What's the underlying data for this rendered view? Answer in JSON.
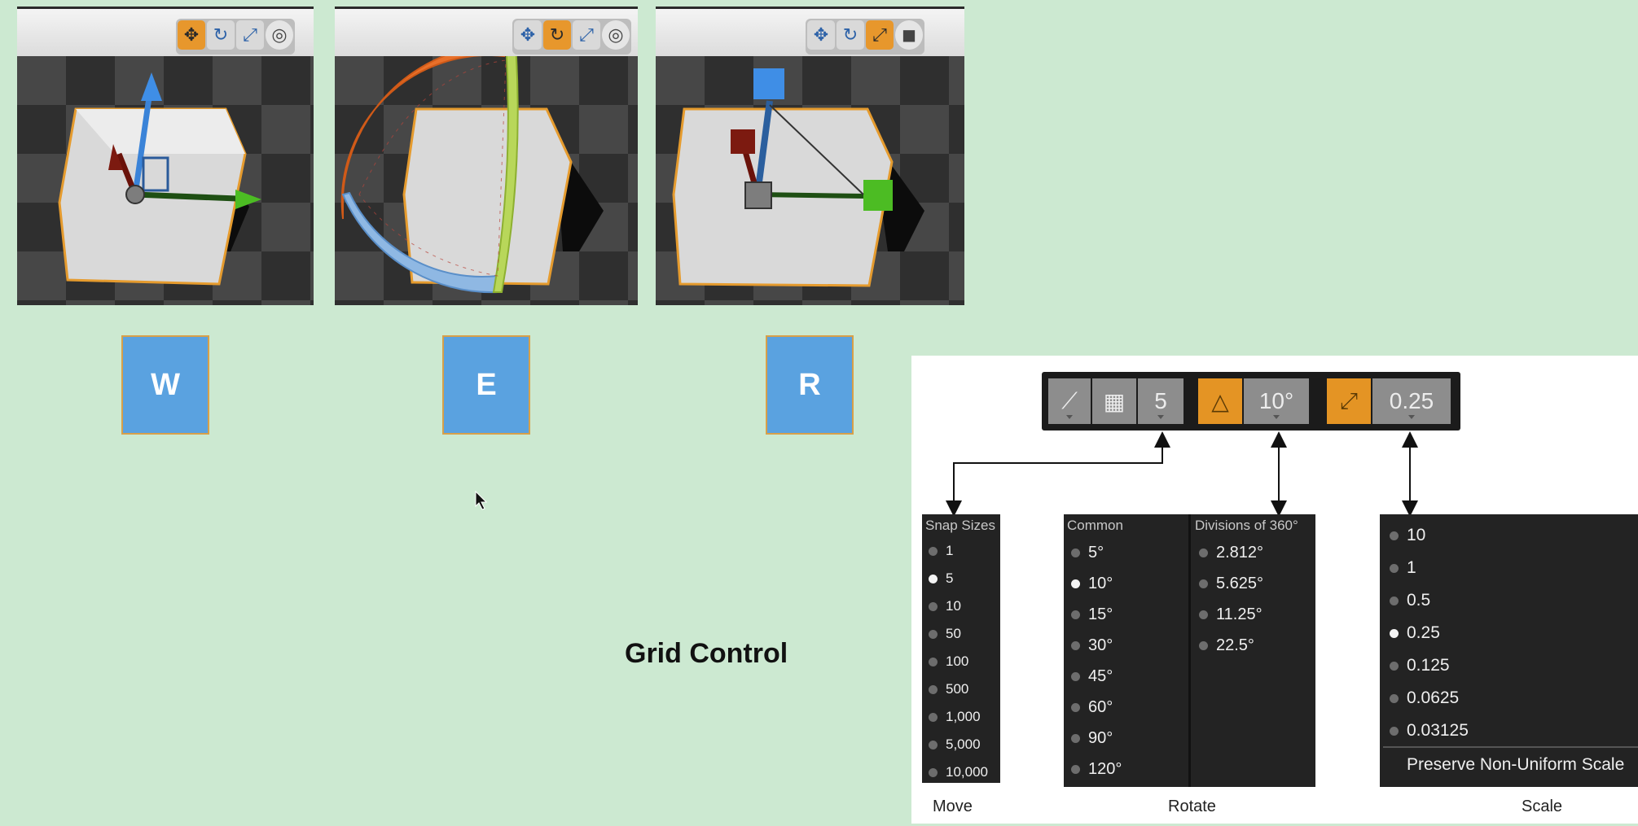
{
  "viewports": [
    {
      "name": "translate",
      "toolbar": [
        "move-icon",
        "rotate-icon",
        "scale-icon",
        "world-icon"
      ],
      "active": 0
    },
    {
      "name": "rotate",
      "toolbar": [
        "move-icon",
        "rotate-icon",
        "scale-icon",
        "world-icon"
      ],
      "active": 1
    },
    {
      "name": "scale",
      "toolbar": [
        "move-icon",
        "rotate-icon",
        "scale-icon",
        "cube-icon"
      ],
      "active": 2
    }
  ],
  "keys": {
    "w": "W",
    "e": "E",
    "r": "R"
  },
  "grid_title": "Grid Control",
  "snap_toolbar": {
    "move_value": "5",
    "rotate_value": "10°",
    "scale_value": "0.25"
  },
  "move_menu": {
    "header": "Snap Sizes",
    "items": [
      "1",
      "5",
      "10",
      "50",
      "100",
      "500",
      "1,000",
      "5,000",
      "10,000"
    ],
    "selected": "5"
  },
  "rotate_menu": {
    "common_header": "Common",
    "common_items": [
      "5°",
      "10°",
      "15°",
      "30°",
      "45°",
      "60°",
      "90°",
      "120°"
    ],
    "selected": "10°",
    "div_header": "Divisions of 360°",
    "div_items": [
      "2.812°",
      "5.625°",
      "11.25°",
      "22.5°"
    ]
  },
  "scale_menu": {
    "items": [
      "10",
      "1",
      "0.5",
      "0.25",
      "0.125",
      "0.0625",
      "0.03125"
    ],
    "selected": "0.25",
    "footer": "Preserve Non-Uniform Scale"
  },
  "captions": {
    "move": "Move",
    "rotate": "Rotate",
    "scale": "Scale"
  },
  "colors": {
    "background": "#cce9d1",
    "accent_orange": "#e7972c",
    "key_blue": "#5aa2e0"
  }
}
